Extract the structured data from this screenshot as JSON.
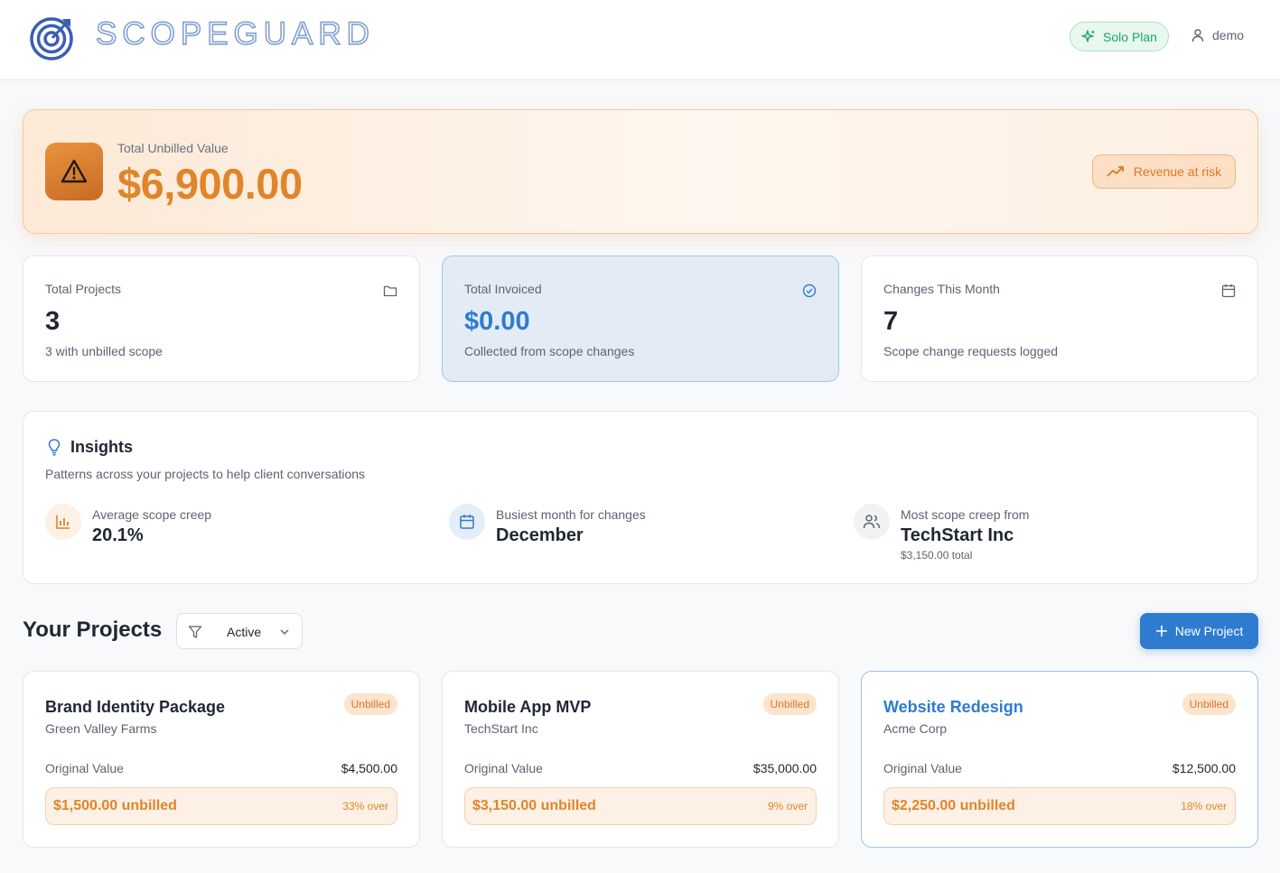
{
  "header": {
    "brand": "SCOPEGUARD",
    "plan_label": "Solo Plan",
    "username": "demo"
  },
  "alert": {
    "label": "Total Unbilled Value",
    "value": "$6,900.00",
    "badge": "Revenue at risk"
  },
  "stats": [
    {
      "label": "Total Projects",
      "value": "3",
      "sub": "3 with unbilled scope",
      "icon": "folder-icon"
    },
    {
      "label": "Total Invoiced",
      "value": "$0.00",
      "sub": "Collected from scope changes",
      "icon": "check-circle-icon"
    },
    {
      "label": "Changes This Month",
      "value": "7",
      "sub": "Scope change requests logged",
      "icon": "calendar-icon"
    }
  ],
  "insights": {
    "title": "Insights",
    "subtitle": "Patterns across your projects to help client conversations",
    "items": [
      {
        "label": "Average scope creep",
        "value": "20.1%",
        "icon": "bar-chart-icon"
      },
      {
        "label": "Busiest month for changes",
        "value": "December",
        "icon": "calendar-icon"
      },
      {
        "label": "Most scope creep from",
        "value": "TechStart Inc",
        "note": "$3,150.00 total",
        "icon": "users-icon"
      }
    ]
  },
  "projects": {
    "title": "Your Projects",
    "filter_value": "Active",
    "new_label": "New Project",
    "original_label": "Original Value",
    "items": [
      {
        "name": "Brand Identity Package",
        "client": "Green Valley Farms",
        "status": "Unbilled",
        "original": "$4,500.00",
        "unbilled": "$1,500.00 unbilled",
        "over": "33% over"
      },
      {
        "name": "Mobile App MVP",
        "client": "TechStart Inc",
        "status": "Unbilled",
        "original": "$35,000.00",
        "unbilled": "$3,150.00 unbilled",
        "over": "9% over"
      },
      {
        "name": "Website Redesign",
        "client": "Acme Corp",
        "status": "Unbilled",
        "original": "$12,500.00",
        "unbilled": "$2,250.00 unbilled",
        "over": "18% over"
      }
    ]
  },
  "colors": {
    "accent_blue": "#2f7bd0",
    "warning_orange": "#e0852a",
    "success_green": "#1ea664"
  }
}
